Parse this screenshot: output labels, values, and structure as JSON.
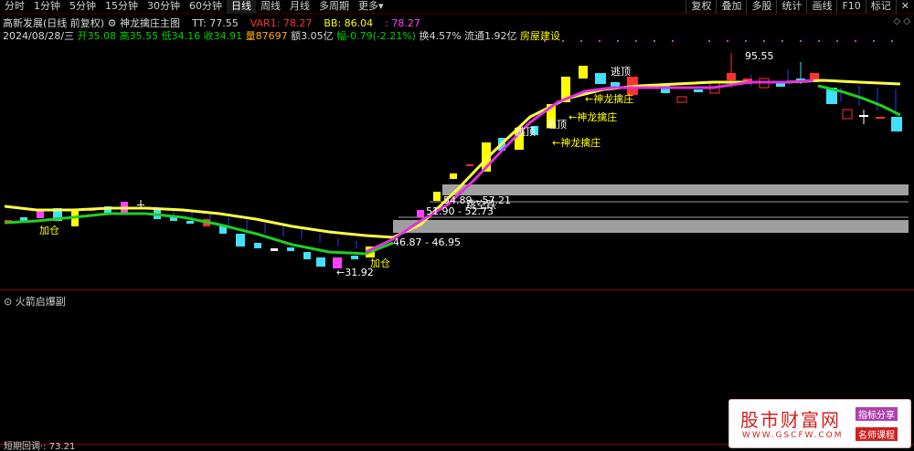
{
  "toolbar": {
    "periods": [
      "分时",
      "1分钟",
      "5分钟",
      "15分钟",
      "30分钟",
      "60分钟",
      "日线",
      "周线",
      "月线",
      "多周期",
      "更多"
    ],
    "active_period": "日线",
    "more_arrow": "▾",
    "right_buttons": [
      "复权",
      "叠加",
      "多股",
      "统计",
      "画线",
      "F10",
      "标记"
    ],
    "close": "✕"
  },
  "header": {
    "stock_title": "高新发展(日线 前复权)",
    "indicator_icon": "gear-icon",
    "indicator_name": "神龙擒庄主图",
    "tt_label": "TT: 77.55",
    "var1_label": "VAR1: 78.27",
    "bb_label": "BB: 86.04",
    "dot_value": ": 78.27",
    "date": "2024/08/28/三",
    "open": "开35.08",
    "high": "高35.55",
    "low": "低34.16",
    "close": "收34.91",
    "volume": "量87697",
    "amount": "额3.05亿",
    "change": "幅-0.79(-2.21%)",
    "turnover": "换4.57%",
    "float_cap": "流通1.92亿",
    "sector": "房屋建设",
    "corner_icons": "◇ ◇"
  },
  "chart_annotations": {
    "add1": "加仓",
    "add2": "加仓",
    "low_price": "←31.92",
    "high_price": "95.55",
    "range1": "46.87 - 46.95",
    "range2": "51.90 - 52.73",
    "range3": "54.89 - 57.21",
    "jump": "跳空跌",
    "escape1": "逃顶",
    "escape2": "逃顶",
    "escape3": "逃顶",
    "shenlong1": "←神龙擒庄",
    "shenlong2": "←神龙擒庄",
    "shenlong3": "←神龙擒庄"
  },
  "sub_pane": {
    "title": "火箭启爆副",
    "bottom_text": "短期回调·: 73.21"
  },
  "watermark": {
    "main": "股市财富网",
    "url": "WWW.GSCFW.COM",
    "tag1": "指标分享",
    "tag2": "名师课程"
  },
  "colors": {
    "up": "#ff3030",
    "down": "#40e0ff",
    "yellow_line": "#ffff40",
    "magenta_line": "#e030e0",
    "green_line": "#20d020",
    "gray_zone": "#a0a0a0"
  }
}
